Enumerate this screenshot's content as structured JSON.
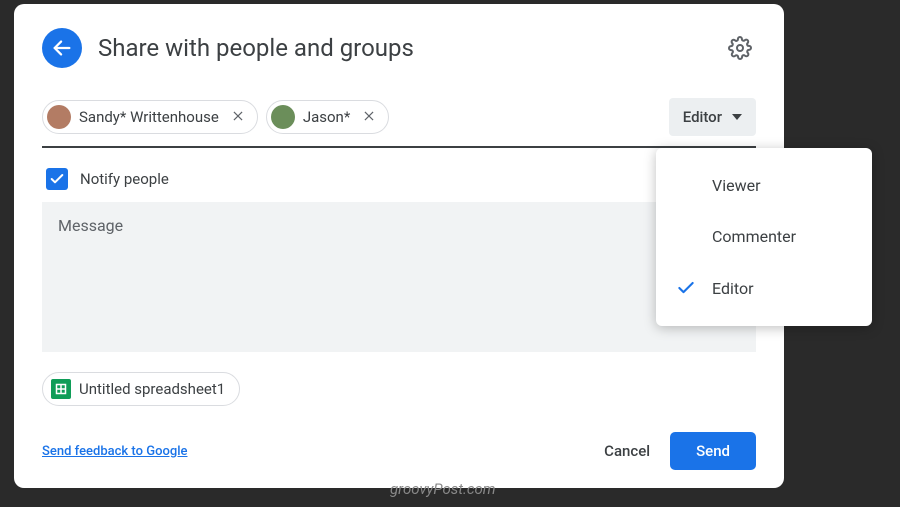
{
  "dialog": {
    "title": "Share with people and groups",
    "people": [
      {
        "name": "Sandy* Writtenhouse",
        "avatar_bg": "#b37c64"
      },
      {
        "name": "Jason*",
        "avatar_bg": "#6b8e5a"
      }
    ],
    "role_selected": "Editor",
    "notify_label": "Notify people",
    "notify_checked": true,
    "message_placeholder": "Message",
    "attachment_name": "Untitled spreadsheet1",
    "feedback_link": "Send feedback to Google",
    "cancel_label": "Cancel",
    "send_label": "Send"
  },
  "dropdown": {
    "options": [
      "Viewer",
      "Commenter",
      "Editor"
    ],
    "selected": "Editor"
  },
  "watermark": "groovyPost.com"
}
